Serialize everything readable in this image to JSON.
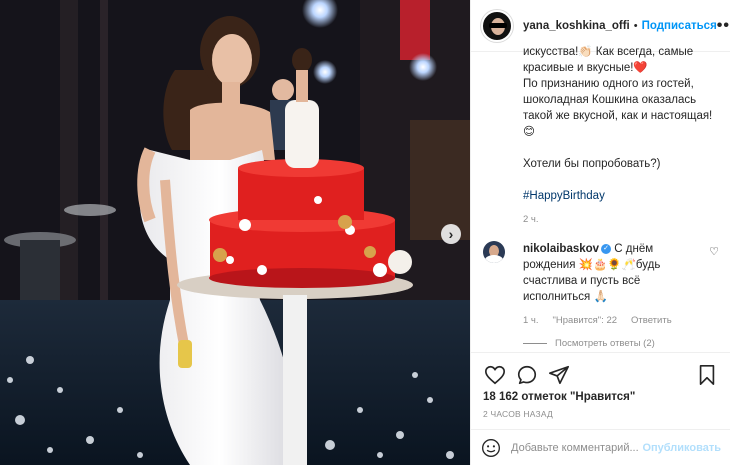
{
  "header": {
    "username": "yana_koshkina_offi",
    "separator": "•",
    "follow_label": "Подписаться",
    "more_label": "•••"
  },
  "caption": {
    "lines": [
      "искусства!👏🏻 Как всегда, самые",
      "красивые и вкусные!❤️",
      "По признанию одного из гостей,",
      "шоколадная Кошкина оказалась",
      "такой же вкусной, как и настоящая!",
      "😊",
      "",
      "Хотели бы попробовать?)",
      ""
    ],
    "hashtag": "#HappyBirthday",
    "time": "2 ч."
  },
  "comment": {
    "username": "nikolaibaskov",
    "verified_mark": "✓",
    "text": " С днём рождения 💥🎂🌻🥂будь счастлива и пусть всё исполниться 🙏🏻",
    "time": "1 ч.",
    "likes": "\"Нравится\": 22",
    "reply_label": "Ответить",
    "view_replies": "Посмотреть ответы (2)"
  },
  "post": {
    "likes_text": "18 162 отметок \"Нравится\"",
    "time_ago": "2 ЧАСОВ НАЗАД"
  },
  "add_comment": {
    "placeholder": "Добавьте комментарий...",
    "publish_label": "Опубликовать"
  },
  "carousel": {
    "next_glyph": "›"
  },
  "colors": {
    "accent": "#0095f6",
    "publish_disabled": "#b2dffc",
    "hashtag": "#00376b",
    "muted": "#8e8e8e",
    "border": "#efefef"
  },
  "icons": [
    "heart-icon",
    "comment-icon",
    "share-icon",
    "bookmark-icon",
    "emoji-icon",
    "more-icon",
    "verified-icon",
    "carousel-next-icon"
  ]
}
